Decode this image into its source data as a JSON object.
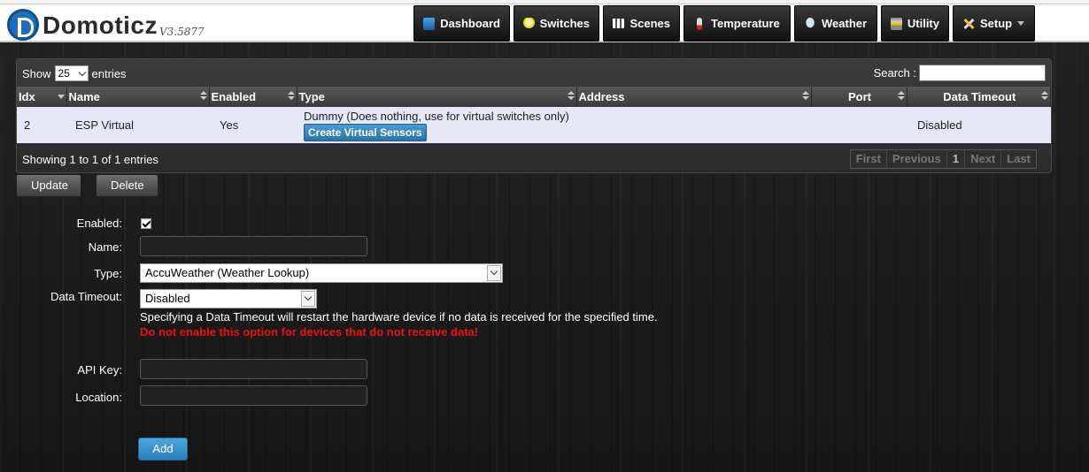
{
  "app": {
    "name": "Domoticz",
    "version": "V3.5877"
  },
  "nav": [
    {
      "label": "Dashboard",
      "icon": "dashboard-icon"
    },
    {
      "label": "Switches",
      "icon": "bulb-icon"
    },
    {
      "label": "Scenes",
      "icon": "scenes-icon"
    },
    {
      "label": "Temperature",
      "icon": "thermometer-icon"
    },
    {
      "label": "Weather",
      "icon": "weather-icon"
    },
    {
      "label": "Utility",
      "icon": "utility-icon"
    },
    {
      "label": "Setup",
      "icon": "setup-tools-icon"
    }
  ],
  "table": {
    "show_label": "Show",
    "entries_value": "25",
    "entries_label": "entries",
    "search_label": "Search :",
    "columns": [
      "Idx",
      "Name",
      "Enabled",
      "Type",
      "Address",
      "Port",
      "Data Timeout"
    ],
    "rows": [
      {
        "idx": "2",
        "name": "ESP Virtual",
        "enabled": "Yes",
        "type": "Dummy (Does nothing, use for virtual switches only)",
        "type_button": "Create Virtual Sensors",
        "address": "",
        "port": "",
        "data_timeout": "Disabled"
      }
    ],
    "info": "Showing 1 to 1 of 1 entries",
    "pager": {
      "first": "First",
      "previous": "Previous",
      "page": "1",
      "next": "Next",
      "last": "Last"
    }
  },
  "actions": {
    "update": "Update",
    "delete": "Delete"
  },
  "form": {
    "enabled_label": "Enabled:",
    "enabled_checked": true,
    "name_label": "Name:",
    "name_value": "",
    "type_label": "Type:",
    "type_value": "AccuWeather (Weather Lookup)",
    "timeout_label": "Data Timeout:",
    "timeout_value": "Disabled",
    "timeout_note": "Specifying a Data Timeout will restart the hardware device if no data is received for the specified time.",
    "timeout_warning": "Do not enable this option for devices that do not receive data!",
    "apikey_label": "API Key:",
    "apikey_value": "",
    "location_label": "Location:",
    "location_value": "",
    "add_label": "Add"
  },
  "colors": {
    "row_bg": "#e6e8f7",
    "accent_blue": "#2b7fbd",
    "warning_red": "#ee1111"
  }
}
